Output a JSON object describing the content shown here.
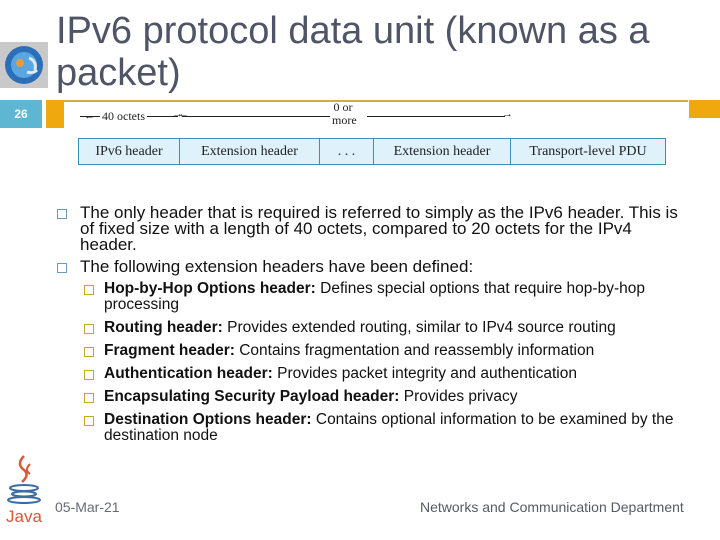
{
  "slide": {
    "title": "IPv6 protocol data unit (known as a packet)",
    "slide_number": "26",
    "colors": {
      "accent": "#efa90f",
      "slide_number_bg": "#5fb6d3",
      "title": "#4f5566",
      "diagram_fill": "#dff1fb",
      "diagram_border": "#3b8fb8"
    }
  },
  "diagram": {
    "dim_octets": "40 octets",
    "dim_more_line1": "0 or",
    "dim_more_line2": "more",
    "cells": [
      "IPv6 header",
      "Extension header",
      ". . .",
      "Extension header",
      "Transport-level PDU"
    ]
  },
  "bullets": [
    {
      "text": "The only header that is required is referred to simply as the IPv6 header. This is of fixed size with a length of 40 octets, compared to 20 octets for the IPv4 header."
    },
    {
      "text": "The following extension headers have been defined:"
    }
  ],
  "sub_bullets": [
    {
      "term": "Hop-by-Hop Options header:",
      "desc": " Defines special options that require hop-by-hop processing"
    },
    {
      "term": "Routing header:",
      "desc": " Provides extended routing, similar to IPv4 source routing"
    },
    {
      "term": "Fragment header:",
      "desc": " Contains fragmentation and reassembly information"
    },
    {
      "term": "Authentication header:",
      "desc": " Provides packet integrity and authentication"
    },
    {
      "term": "Encapsulating Security Payload header:",
      "desc": " Provides privacy"
    },
    {
      "term": "Destination Options header:",
      "desc": " Contains optional information to be examined by the destination node"
    }
  ],
  "footer": {
    "date": "05-Mar-21",
    "department": "Networks and Communication Department"
  },
  "icons": {
    "top_left": "globe-logo-icon",
    "bottom_left": "java-logo-icon"
  }
}
